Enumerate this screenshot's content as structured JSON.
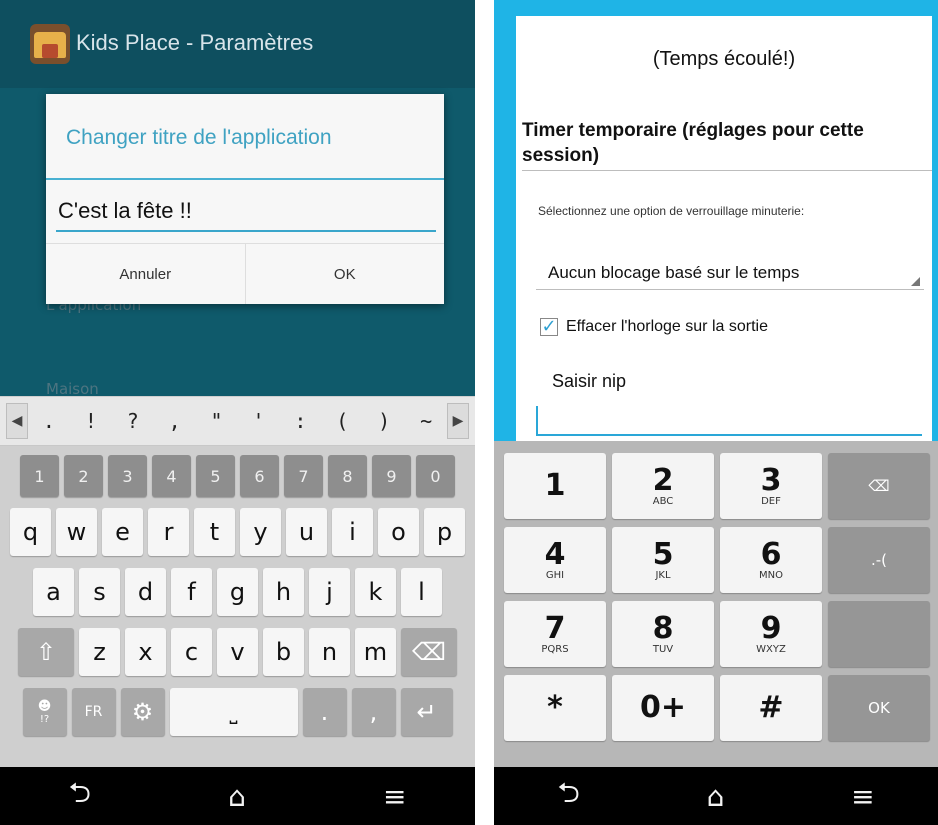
{
  "left_screen": {
    "app_title": "Kids Place - Paramètres",
    "background_text_1": "L'application",
    "background_text_2": "Maison",
    "dialog": {
      "title": "Changer titre de l'application",
      "input_value": "C'est la fête !!",
      "cancel_label": "Annuler",
      "ok_label": "OK"
    },
    "symbol_row": [
      ".",
      "!",
      "?",
      ",",
      "\"",
      "'",
      ":",
      "(",
      ")",
      "~"
    ],
    "number_row": [
      "1",
      "2",
      "3",
      "4",
      "5",
      "6",
      "7",
      "8",
      "9",
      "0"
    ],
    "row_q": [
      "q",
      "w",
      "e",
      "r",
      "t",
      "y",
      "u",
      "i",
      "o",
      "p"
    ],
    "row_a": [
      "a",
      "s",
      "d",
      "f",
      "g",
      "h",
      "j",
      "k",
      "l"
    ],
    "row_z": [
      "z",
      "x",
      "c",
      "v",
      "b",
      "n",
      "m"
    ],
    "lang_label": "FR",
    "emoji_label": "!?",
    "period": ".",
    "comma": ","
  },
  "right_screen": {
    "elapsed_text": "(Temps écoulé!)",
    "section_title": "Timer temporaire (réglages pour cette session)",
    "select_label": "Sélectionnez une option de verrouillage minuterie:",
    "select_value": "Aucun blocage basé sur le temps",
    "checkbox_label": "Effacer l'horloge sur la sortie",
    "checkbox_checked": true,
    "pin_label": "Saisir nip",
    "numpad": {
      "k1": "1",
      "k2": "2",
      "k2_letters": "ABC",
      "k3": "3",
      "k3_letters": "DEF",
      "k4": "4",
      "k4_letters": "GHI",
      "k5": "5",
      "k5_letters": "JKL",
      "k6": "6",
      "k6_letters": "MNO",
      "k7": "7",
      "k7_letters": "PQRS",
      "k8": "8",
      "k8_letters": "TUV",
      "k9": "9",
      "k9_letters": "WXYZ",
      "star": "*",
      "zero": "0+",
      "hash": "#",
      "smiley": ".-(",
      "ok": "OK"
    }
  },
  "colors": {
    "accent": "#3aa6cb",
    "left_bg": "#0f5a6b",
    "right_bg": "#1fb4e6"
  }
}
